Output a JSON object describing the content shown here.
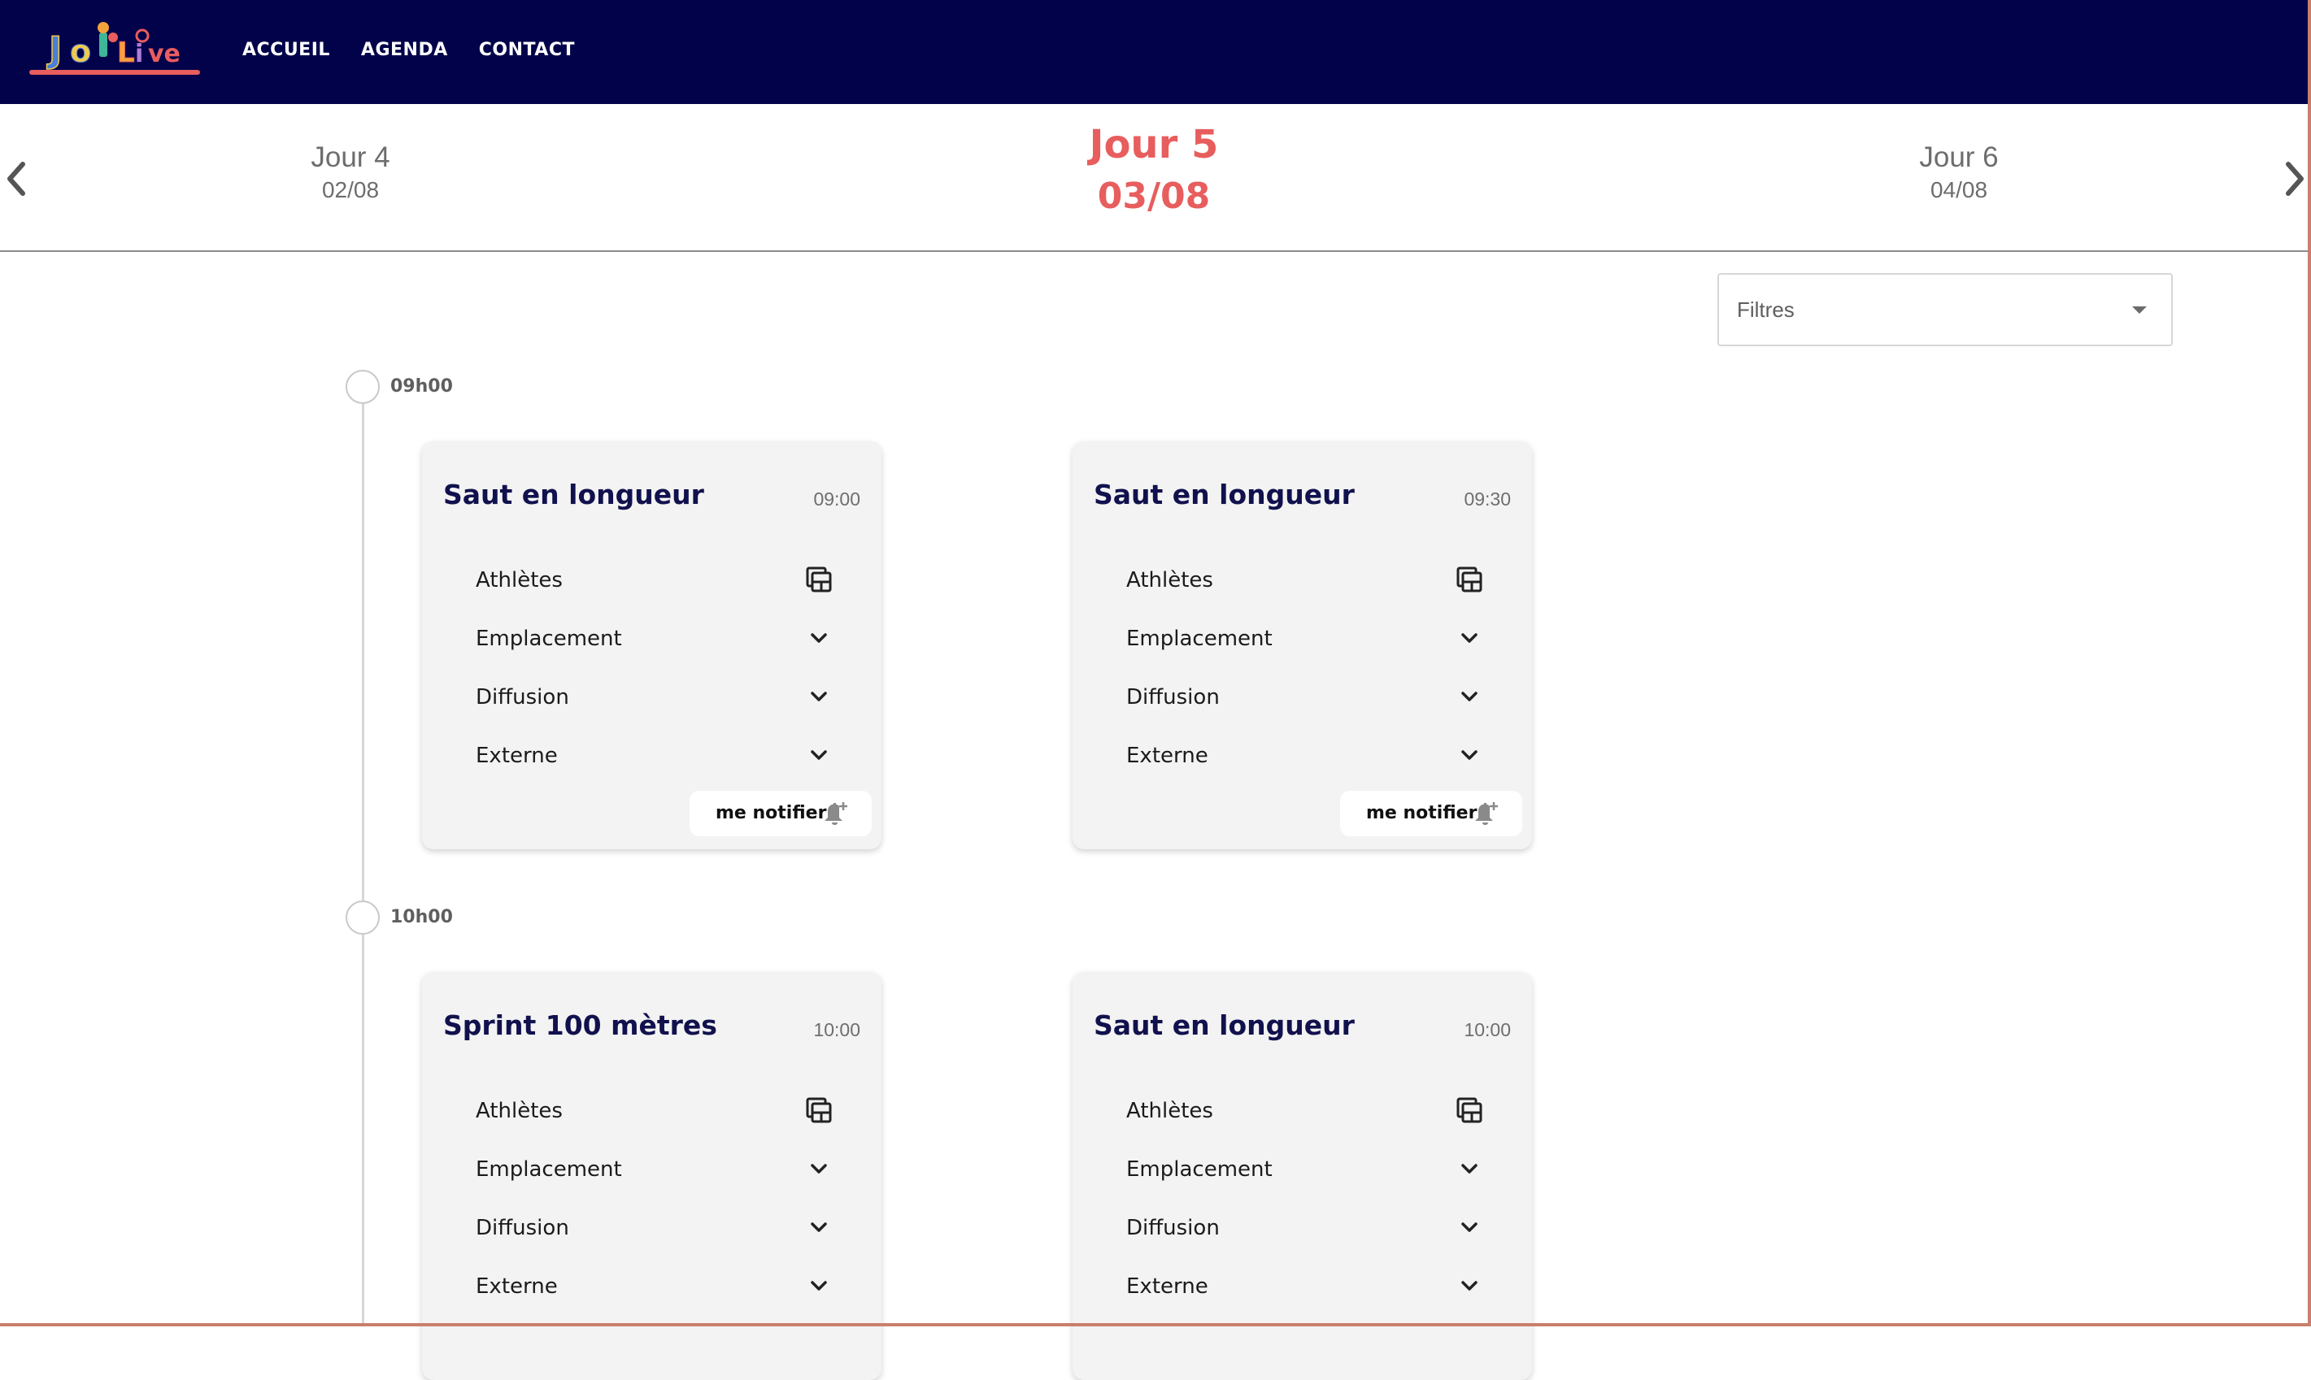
{
  "nav": {
    "logo_text": "JO Live",
    "links": [
      "ACCUEIL",
      "AGENDA",
      "CONTACT"
    ]
  },
  "days": {
    "prev": {
      "name": "Jour 4",
      "date": "02/08"
    },
    "current": {
      "name": "Jour 5",
      "date": "03/08"
    },
    "next": {
      "name": "Jour 6",
      "date": "04/08"
    }
  },
  "filter": {
    "label": "Filtres"
  },
  "slots": [
    {
      "label": "09h00",
      "events": [
        {
          "title": "Saut en longueur",
          "time": "09:00"
        },
        {
          "title": "Saut en longueur",
          "time": "09:30"
        }
      ]
    },
    {
      "label": "10h00",
      "events": [
        {
          "title": "Sprint 100 mètres",
          "time": "10:00"
        },
        {
          "title": "Saut en longueur",
          "time": "10:00"
        }
      ]
    }
  ],
  "card_rows": {
    "athletes": "Athlètes",
    "emplacement": "Emplacement",
    "diffusion": "Diffusion",
    "externe": "Externe"
  },
  "notify_label": "me notifier",
  "colors": {
    "navbar": "#02024a",
    "accent": "#e85d5d",
    "card_title": "#11114e",
    "card_bg": "#f3f3f3"
  }
}
